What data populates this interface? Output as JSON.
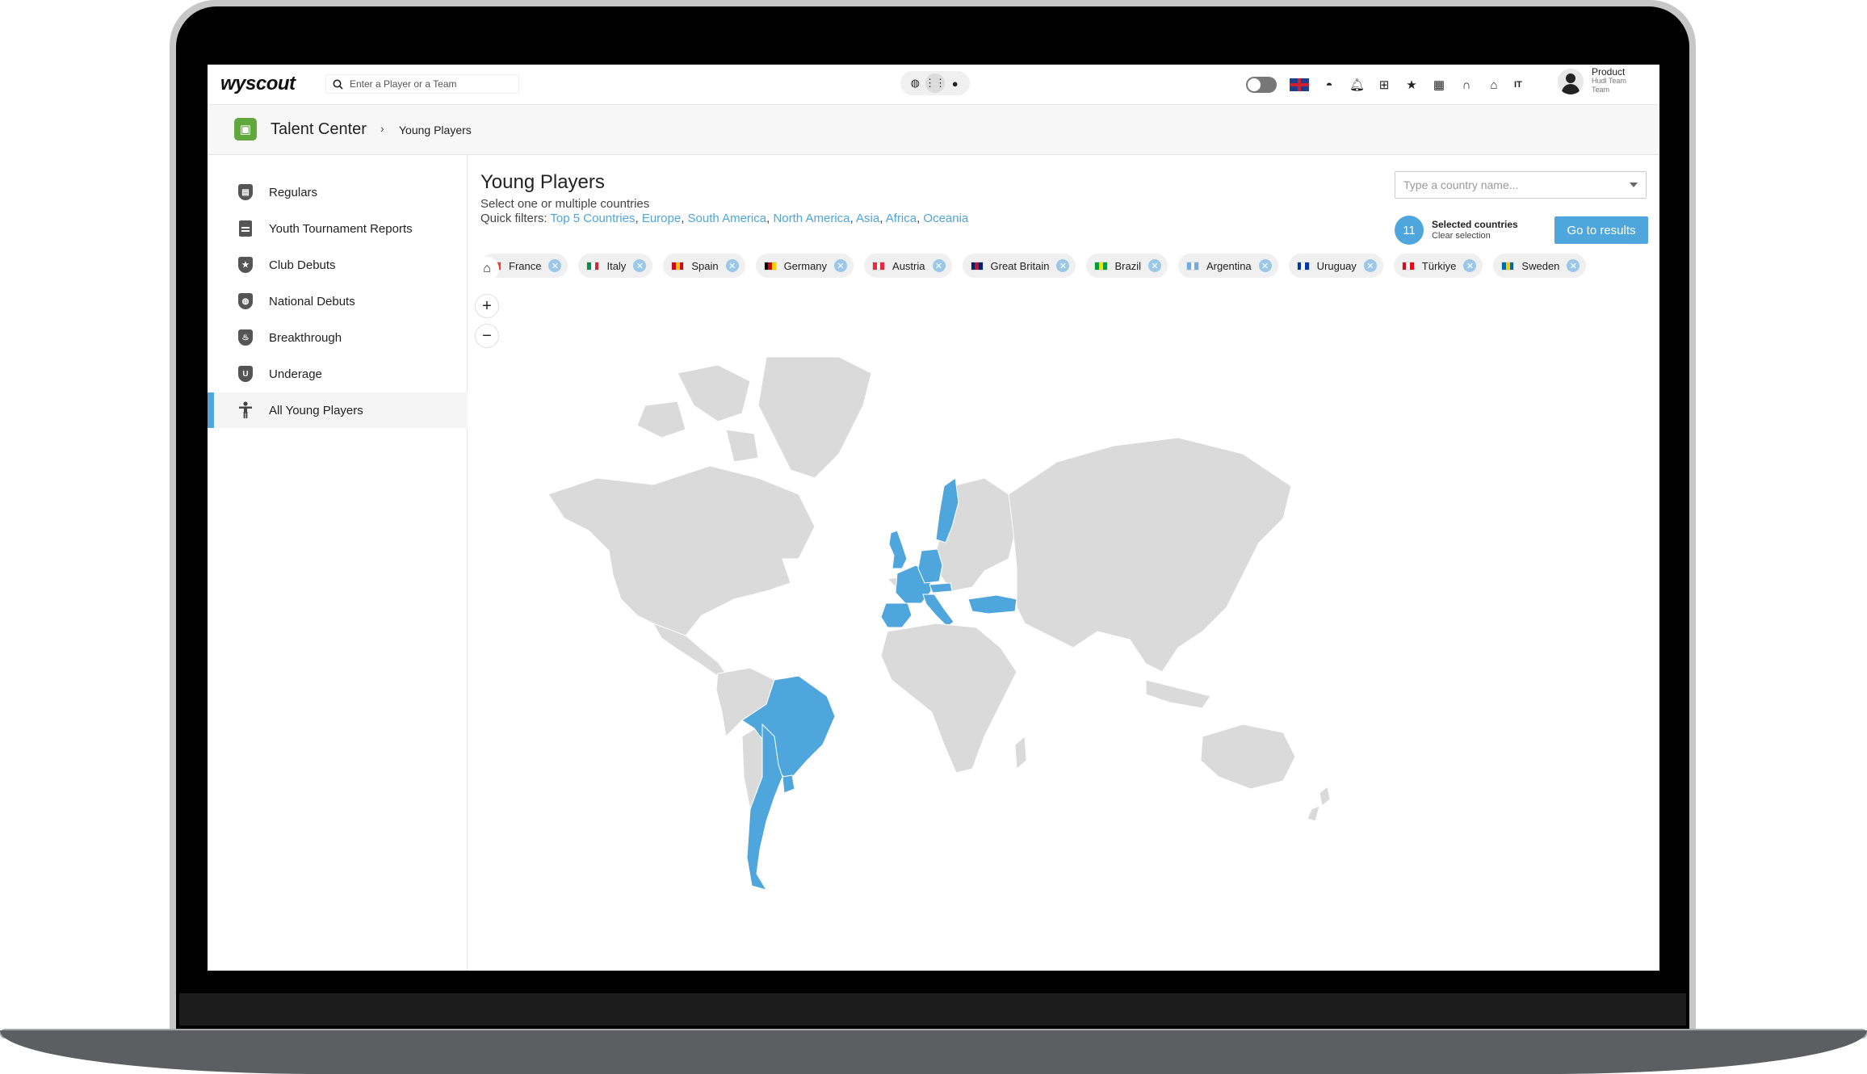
{
  "topbar": {
    "logo": "wyscout",
    "search_placeholder": "Enter a Player or a Team",
    "language": "IT",
    "user": {
      "name": "Product",
      "team": "Hudl Team Team"
    }
  },
  "breadcrumb": {
    "section": "Talent Center",
    "separator": "›",
    "page": "Young Players"
  },
  "sidebar": {
    "items": [
      {
        "label": "Regulars",
        "icon": "shield-calendar-icon"
      },
      {
        "label": "Youth Tournament Reports",
        "icon": "document-icon"
      },
      {
        "label": "Club Debuts",
        "icon": "shield-star-icon"
      },
      {
        "label": "National Debuts",
        "icon": "shield-globe-icon"
      },
      {
        "label": "Breakthrough",
        "icon": "shield-flame-icon"
      },
      {
        "label": "Underage",
        "icon": "shield-u-icon"
      },
      {
        "label": "All Young Players",
        "icon": "person-icon",
        "active": true
      }
    ]
  },
  "main": {
    "title": "Young Players",
    "subtitle": "Select one or multiple countries",
    "quick_filters_label": "Quick filters:",
    "quick_filters": [
      "Top 5 Countries",
      "Europe",
      "South America",
      "North America",
      "Asia",
      "Africa",
      "Oceania"
    ],
    "country_placeholder": "Type a country name...",
    "selected_count": "11",
    "selected_label": "Selected countries",
    "clear_label": "Clear selection",
    "go_button": "Go to results"
  },
  "chips": [
    {
      "name": "France",
      "colors": [
        "#0055a4",
        "#ffffff",
        "#ef4135"
      ]
    },
    {
      "name": "Italy",
      "colors": [
        "#009246",
        "#ffffff",
        "#ce2b37"
      ]
    },
    {
      "name": "Spain",
      "colors": [
        "#c60b1e",
        "#ffc400",
        "#c60b1e"
      ]
    },
    {
      "name": "Germany",
      "colors": [
        "#000000",
        "#dd0000",
        "#ffce00"
      ]
    },
    {
      "name": "Austria",
      "colors": [
        "#ed2939",
        "#ffffff",
        "#ed2939"
      ]
    },
    {
      "name": "Great Britain",
      "colors": [
        "#012169",
        "#c8102e",
        "#012169"
      ]
    },
    {
      "name": "Brazil",
      "colors": [
        "#009c3b",
        "#ffdf00",
        "#009c3b"
      ]
    },
    {
      "name": "Argentina",
      "colors": [
        "#74acdf",
        "#ffffff",
        "#74acdf"
      ]
    },
    {
      "name": "Uruguay",
      "colors": [
        "#0038a8",
        "#ffffff",
        "#0038a8"
      ]
    },
    {
      "name": "Türkiye",
      "colors": [
        "#e30a17",
        "#ffffff",
        "#e30a17"
      ]
    },
    {
      "name": "Sweden",
      "colors": [
        "#006aa7",
        "#fecc00",
        "#006aa7"
      ]
    }
  ],
  "colors": {
    "accent": "#4ea6dc",
    "land": "#dadada",
    "selected_land": "#4ea6dc"
  }
}
